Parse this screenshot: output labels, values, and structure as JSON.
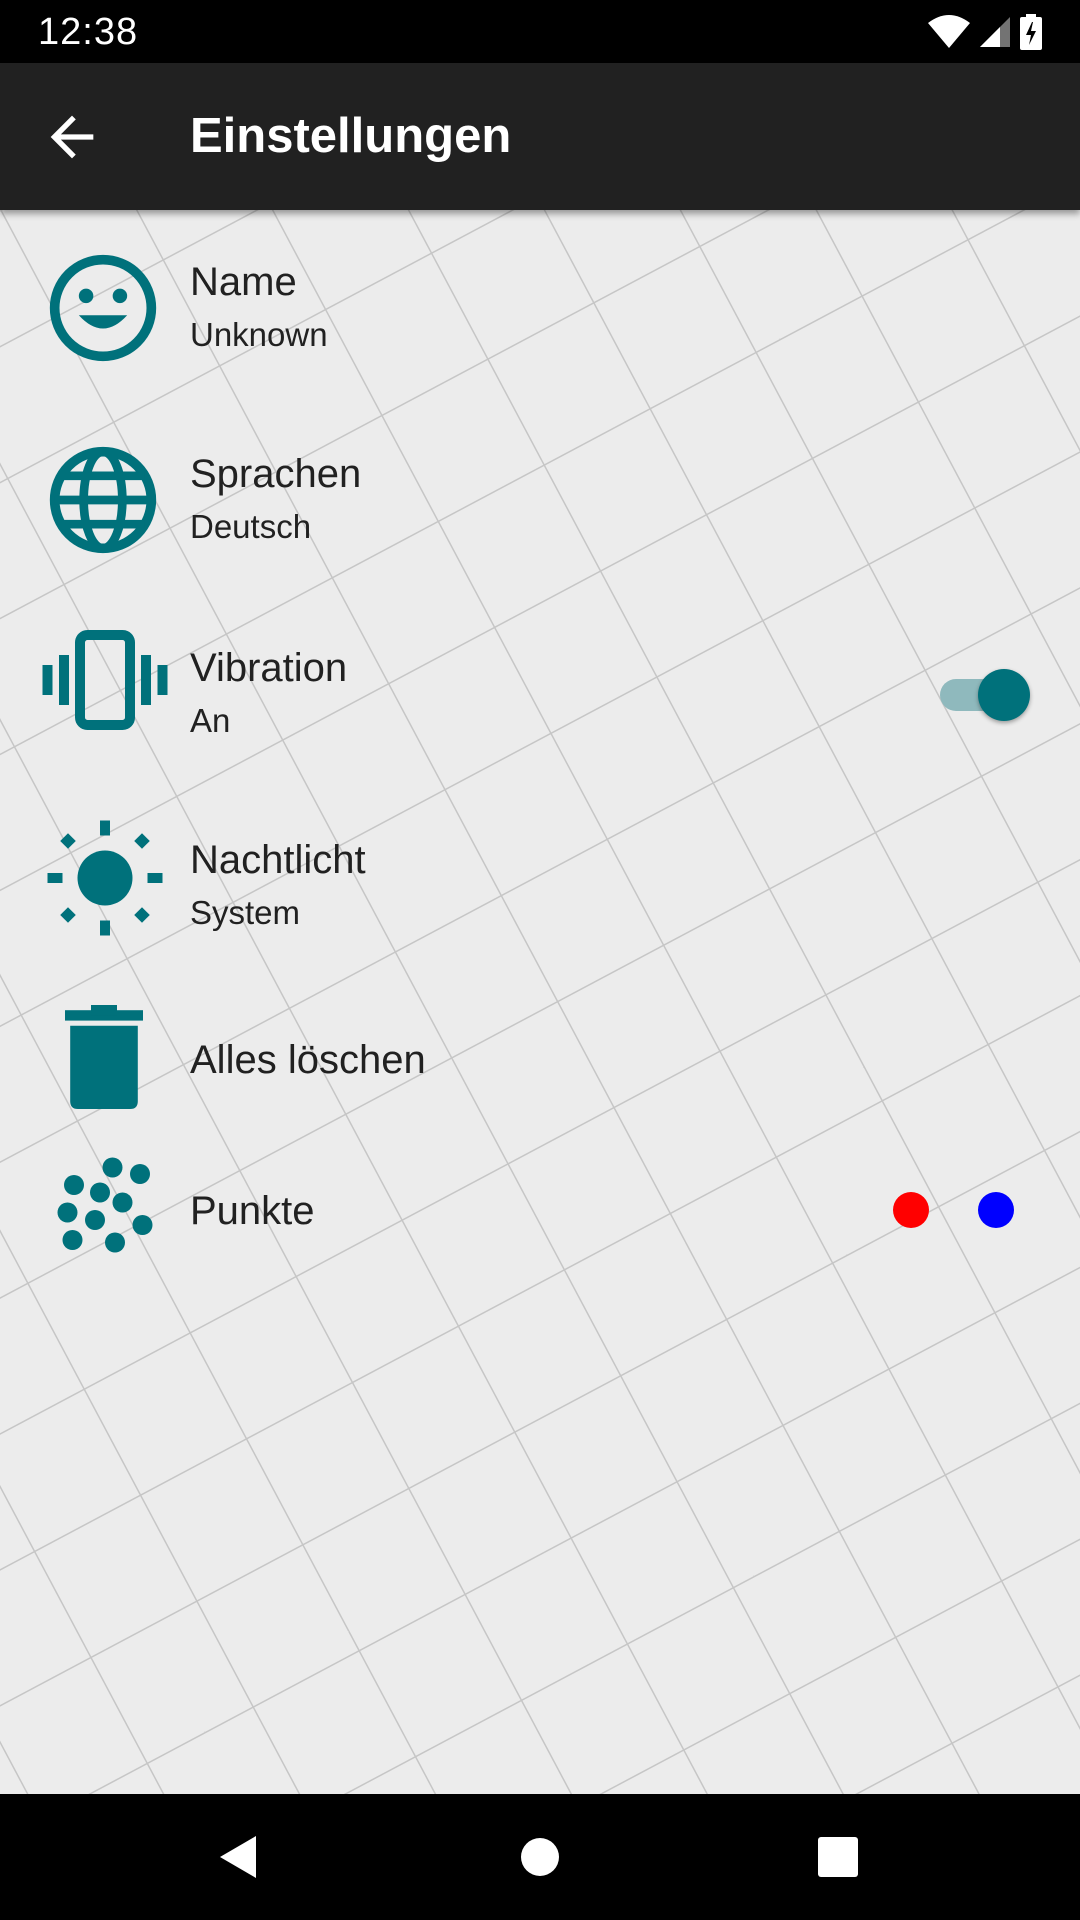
{
  "status_bar": {
    "time": "12:38",
    "icons": [
      "wifi-icon",
      "cell-signal-icon",
      "battery-charging-icon"
    ]
  },
  "app_bar": {
    "title": "Einstellungen",
    "back_icon": "arrow-back-icon"
  },
  "settings": [
    {
      "key": "name",
      "title": "Name",
      "subtitle": "Unknown",
      "icon": "smiley-face-icon"
    },
    {
      "key": "language",
      "title": "Sprachen",
      "subtitle": "Deutsch",
      "icon": "globe-icon"
    },
    {
      "key": "vibration",
      "title": "Vibration",
      "subtitle": "An",
      "icon": "vibration-icon",
      "toggle_on": true
    },
    {
      "key": "nightlight",
      "title": "Nachtlicht",
      "subtitle": "System",
      "icon": "sun-icon"
    },
    {
      "key": "delete",
      "title": "Alles löschen",
      "icon": "trash-icon"
    },
    {
      "key": "dots",
      "title": "Punkte",
      "icon": "dots-icon",
      "dot_colors": [
        "#ff0000",
        "#0000ff"
      ]
    }
  ],
  "nav_bar": {
    "buttons": [
      "back-triangle-icon",
      "home-circle-icon",
      "recents-square-icon"
    ]
  },
  "colors": {
    "accent": "#00717b",
    "app_bar": "#212121",
    "background": "#ececec",
    "text": "#212121"
  }
}
